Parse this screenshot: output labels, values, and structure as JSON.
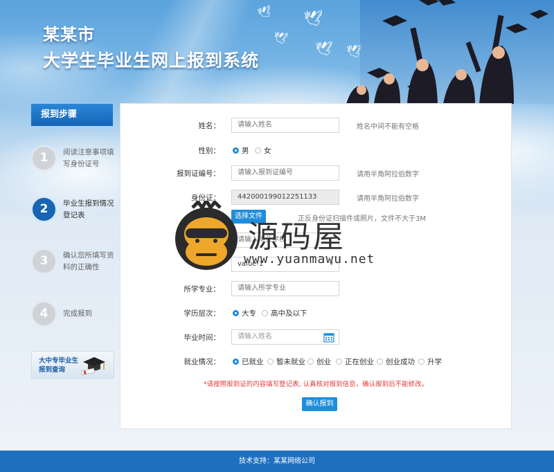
{
  "header": {
    "title_line1": "某某市",
    "title_line2": "大学生毕业生网上报到系统"
  },
  "sidebar": {
    "heading": "报到步骤",
    "steps": [
      {
        "num": "1",
        "label": "阅读注意事项填写身份证号",
        "active": false
      },
      {
        "num": "2",
        "label": "毕业生报到情况登记表",
        "active": true
      },
      {
        "num": "3",
        "label": "确认您所填写资料的正确性",
        "active": false
      },
      {
        "num": "4",
        "label": "完成报到",
        "active": false
      }
    ],
    "banner": {
      "line1": "大中专毕业生",
      "line2": "报到查询",
      "icon": "graduation-cap-icon"
    }
  },
  "form": {
    "name": {
      "label": "姓名：",
      "placeholder": "请输入姓名",
      "hint": "姓名中间不能有空格"
    },
    "gender": {
      "label": "性别：",
      "options": [
        "男",
        "女"
      ],
      "selected": "男"
    },
    "cert_no": {
      "label": "报到证编号：",
      "placeholder": "请输入报到证编号",
      "hint": "请用半角阿拉伯数字"
    },
    "id_card": {
      "label": "身份证：",
      "value": "442000199012251133",
      "hint": "请用半角阿拉伯数字"
    },
    "upload": {
      "button": "选择文件",
      "hint": "正反身份证扫描件或照片，文件不大于3M"
    },
    "hidden_input": {
      "placeholder": "请输入毕业学校"
    },
    "select": {
      "value": "value-1"
    },
    "major": {
      "label": "所学专业：",
      "placeholder": "请输入所学专业"
    },
    "education": {
      "label": "学历层次：",
      "options": [
        "大专",
        "高中及以下"
      ],
      "selected": "大专"
    },
    "grad_time": {
      "label": "毕业时间：",
      "placeholder": "请输入姓名",
      "icon": "calendar-icon"
    },
    "employment": {
      "label": "就业情况：",
      "options": [
        "已就业",
        "暂未就业",
        "创业",
        "正在创业",
        "创业成功",
        "升学"
      ],
      "selected": "已就业"
    },
    "notice": "*请按照报到证的内容填写登记表, 认真核对报到信息，确认报到后不能修改。",
    "submit": "确认报到"
  },
  "watermark": {
    "text": "源码屋",
    "url": "www.yuanmawu.net"
  },
  "footer": {
    "text": "技术支持：某某网络公司"
  },
  "colors": {
    "accent": "#1e8ddb",
    "sidebar_head": "#1466b8",
    "footer": "#1f6fbf",
    "notice": "#e23a3a"
  }
}
